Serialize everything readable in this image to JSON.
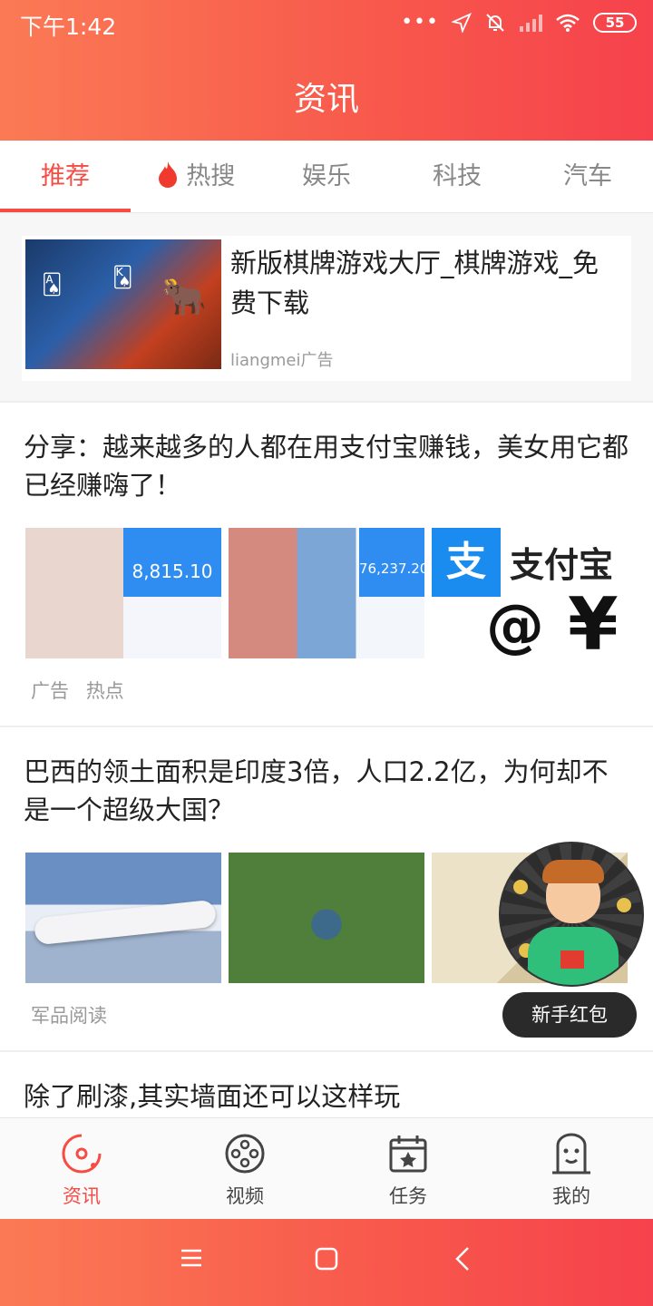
{
  "status_bar": {
    "time": "下午1:42",
    "battery": "55"
  },
  "header": {
    "title": "资讯"
  },
  "tabs": [
    {
      "label": "推荐",
      "active": true
    },
    {
      "label": "热搜",
      "icon": "fire-icon"
    },
    {
      "label": "娱乐"
    },
    {
      "label": "科技"
    },
    {
      "label": "汽车"
    }
  ],
  "feed": {
    "ad": {
      "title": "新版棋牌游戏大厅_棋牌游戏_免费下载",
      "source": "liangmei广告"
    },
    "items": [
      {
        "title": "分享：越来越多的人都在用支付宝赚钱，美女用它都已经赚嗨了！",
        "tags": [
          "广告",
          "热点"
        ],
        "image_texts": [
          "8,815.10",
          "76,237.20",
          "支付宝"
        ]
      },
      {
        "title": "巴西的领土面积是印度3倍，人口2.2亿，为何却不是一个超级大国？",
        "tags": [
          "军品阅读"
        ]
      },
      {
        "title": "除了刷漆,其实墙面还可以这样玩"
      }
    ]
  },
  "floating_promo": {
    "label": "新手红包"
  },
  "bottom_nav": [
    {
      "label": "资讯",
      "icon": "news-icon",
      "active": true
    },
    {
      "label": "视频",
      "icon": "film-reel-icon"
    },
    {
      "label": "任务",
      "icon": "calendar-star-icon"
    },
    {
      "label": "我的",
      "icon": "profile-icon"
    }
  ],
  "colors": {
    "accent": "#f54c44",
    "header_start": "#fb7a55",
    "header_end": "#f6424c"
  }
}
